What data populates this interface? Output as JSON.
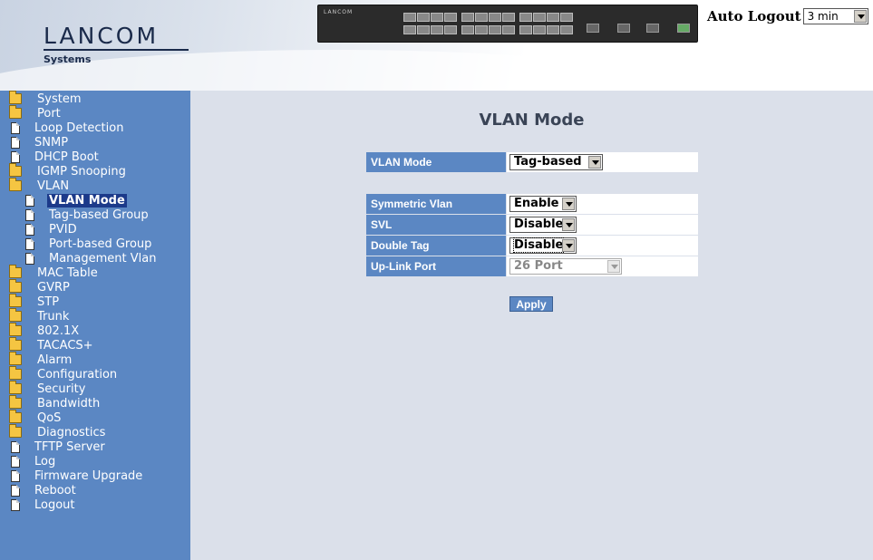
{
  "header": {
    "brand": "LANCOM",
    "brand_sub": "Systems",
    "device_label": "LANCOM",
    "auto_logout_label": "Auto Logout",
    "auto_logout_value": "3 min"
  },
  "sidebar": {
    "items": [
      {
        "label": "System",
        "icon": "folder-icon"
      },
      {
        "label": "Port",
        "icon": "folder-icon"
      },
      {
        "label": "Loop Detection",
        "icon": "page-icon"
      },
      {
        "label": "SNMP",
        "icon": "page-icon"
      },
      {
        "label": "DHCP Boot",
        "icon": "page-icon"
      },
      {
        "label": "IGMP Snooping",
        "icon": "folder-icon"
      },
      {
        "label": "VLAN",
        "icon": "open-folder-icon"
      },
      {
        "label": "VLAN Mode",
        "icon": "page-icon",
        "active": true,
        "child": true
      },
      {
        "label": "Tag-based Group",
        "icon": "page-icon",
        "child": true
      },
      {
        "label": "PVID",
        "icon": "page-icon",
        "child": true
      },
      {
        "label": "Port-based Group",
        "icon": "page-icon",
        "child": true
      },
      {
        "label": "Management Vlan",
        "icon": "page-icon",
        "child": true
      },
      {
        "label": "MAC Table",
        "icon": "folder-icon"
      },
      {
        "label": "GVRP",
        "icon": "folder-icon"
      },
      {
        "label": "STP",
        "icon": "folder-icon"
      },
      {
        "label": "Trunk",
        "icon": "folder-icon"
      },
      {
        "label": "802.1X",
        "icon": "folder-icon"
      },
      {
        "label": "TACACS+",
        "icon": "folder-icon"
      },
      {
        "label": "Alarm",
        "icon": "folder-icon"
      },
      {
        "label": "Configuration",
        "icon": "folder-icon"
      },
      {
        "label": "Security",
        "icon": "folder-icon"
      },
      {
        "label": "Bandwidth",
        "icon": "folder-icon"
      },
      {
        "label": "QoS",
        "icon": "folder-icon"
      },
      {
        "label": "Diagnostics",
        "icon": "folder-icon"
      },
      {
        "label": "TFTP Server",
        "icon": "page-icon"
      },
      {
        "label": "Log",
        "icon": "page-icon"
      },
      {
        "label": "Firmware Upgrade",
        "icon": "page-icon"
      },
      {
        "label": "Reboot",
        "icon": "page-icon"
      },
      {
        "label": "Logout",
        "icon": "page-icon"
      }
    ]
  },
  "main": {
    "title": "VLAN Mode",
    "vlan_mode": {
      "label": "VLAN Mode",
      "value": "Tag-based"
    },
    "symmetric_vlan": {
      "label": "Symmetric Vlan",
      "value": "Enable"
    },
    "svl": {
      "label": "SVL",
      "value": "Disable"
    },
    "double_tag": {
      "label": "Double Tag",
      "value": "Disable"
    },
    "uplink_port": {
      "label": "Up-Link Port",
      "value": "26 Port",
      "disabled": true
    },
    "apply_label": "Apply"
  },
  "colors": {
    "sidebar_bg": "#5b87c3",
    "main_bg": "#dbe0ea",
    "active_item_bg": "#1c3a8a"
  }
}
